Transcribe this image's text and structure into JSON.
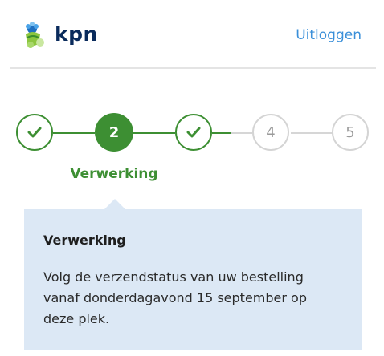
{
  "header": {
    "logo_text": "kpn",
    "logout_label": "Uitloggen"
  },
  "stepper": {
    "steps": [
      {
        "number": "1",
        "state": "done",
        "icon": "check-icon"
      },
      {
        "number": "2",
        "state": "active"
      },
      {
        "number": "3",
        "state": "done",
        "icon": "check-icon"
      },
      {
        "number": "4",
        "state": "pending"
      },
      {
        "number": "5",
        "state": "pending"
      }
    ],
    "active_label": "Verwerking"
  },
  "panel": {
    "title": "Verwerking",
    "text": "Volg de verzendstatus van uw bestelling vanaf donderdagavond 15 september op deze plek."
  },
  "colors": {
    "brand_green": "#3d8f33",
    "link_blue": "#3a8fd9",
    "panel_bg": "#dce8f5",
    "kpn_navy": "#0a2b5c"
  }
}
